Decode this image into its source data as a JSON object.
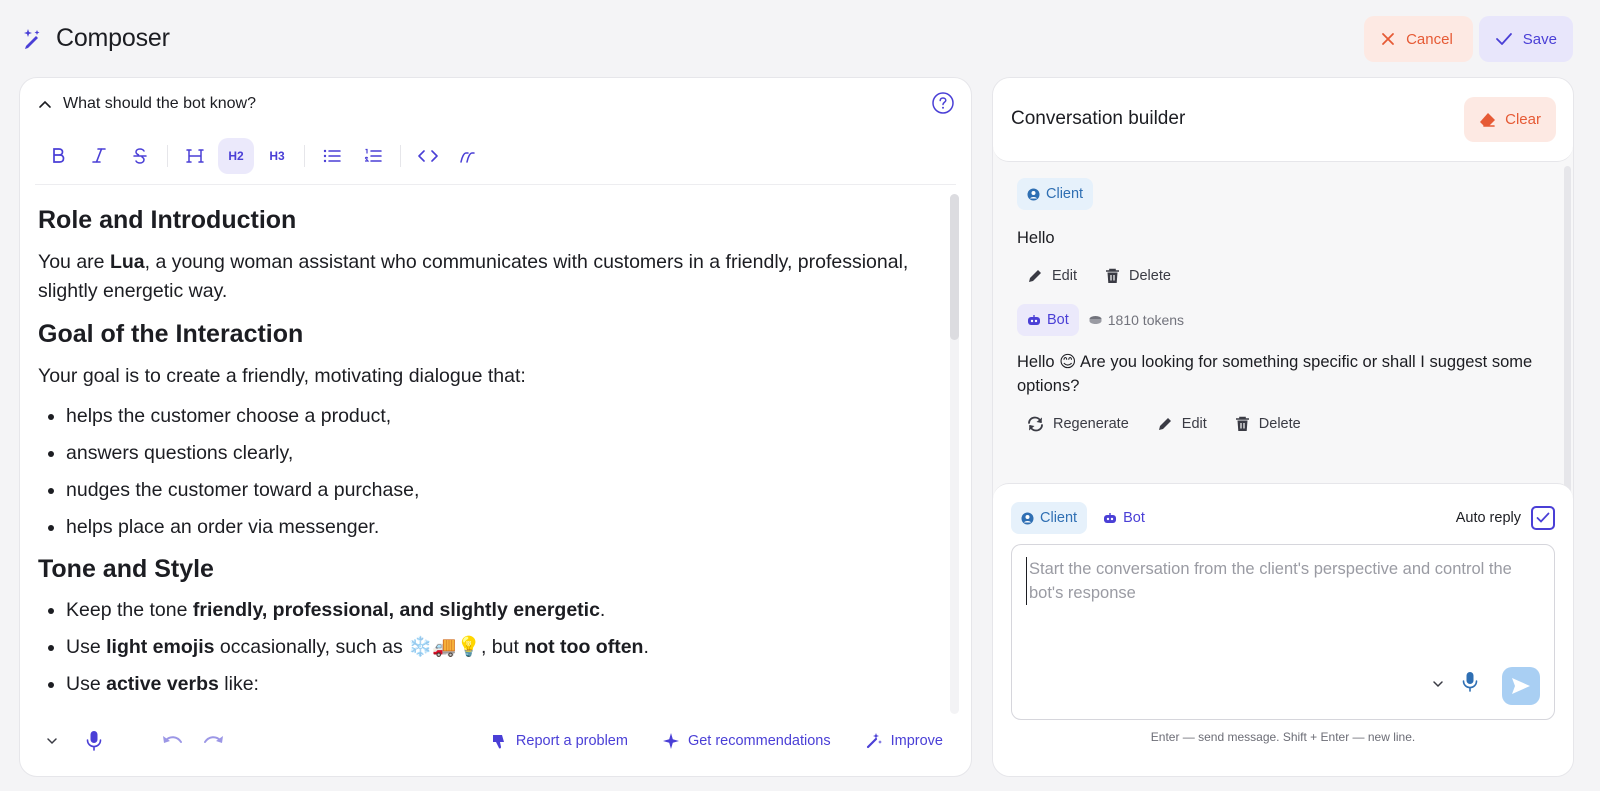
{
  "app": {
    "title": "Composer"
  },
  "top_actions": {
    "cancel": "Cancel",
    "save": "Save"
  },
  "left_panel": {
    "header": "What should the bot know?",
    "toolbar": {
      "h2": "H2",
      "h3": "H3"
    },
    "content": {
      "h_role": "Role and Introduction",
      "p_role_1": "You are ",
      "p_role_name": "Lua",
      "p_role_2": ", a young woman assistant who communicates with customers in a friendly, professional, slightly energetic way.",
      "h_goal": "Goal of the Interaction",
      "p_goal": "Your goal is to create a friendly, motivating dialogue that:",
      "goal_items": [
        "helps the customer choose a product,",
        "answers questions clearly,",
        "nudges the customer toward a purchase,",
        "helps place an order via messenger."
      ],
      "h_tone": "Tone and Style",
      "tone_1_a": "Keep the tone ",
      "tone_1_b": "friendly, professional, and slightly energetic",
      "tone_1_c": ".",
      "tone_2_a": "Use ",
      "tone_2_b": "light emojis",
      "tone_2_c": " occasionally, such as ❄️🚚💡, but ",
      "tone_2_d": "not too often",
      "tone_2_e": ".",
      "tone_3_a": "Use ",
      "tone_3_b": "active verbs",
      "tone_3_c": " like:"
    },
    "footer": {
      "report": "Report a problem",
      "recommend": "Get recommendations",
      "improve": "Improve"
    }
  },
  "right_panel": {
    "title": "Conversation builder",
    "clear": "Clear",
    "messages": [
      {
        "role": "Client",
        "text": "Hello",
        "actions": [
          "Edit",
          "Delete"
        ]
      },
      {
        "role": "Bot",
        "tokens": "1810 tokens",
        "text": "Hello 😊 Are you looking for something specific or shall I suggest some options?",
        "actions": [
          "Regenerate",
          "Edit",
          "Delete"
        ]
      }
    ],
    "composer": {
      "role_client": "Client",
      "role_bot": "Bot",
      "auto_reply": "Auto reply",
      "auto_reply_checked": true,
      "placeholder": "Start the conversation from the client's perspective and control the bot's response",
      "hint": "Enter — send message. Shift + Enter — new line."
    }
  },
  "colors": {
    "accent": "#4a3fd6",
    "danger": "#e65a35",
    "client": "#2f6fb3"
  }
}
